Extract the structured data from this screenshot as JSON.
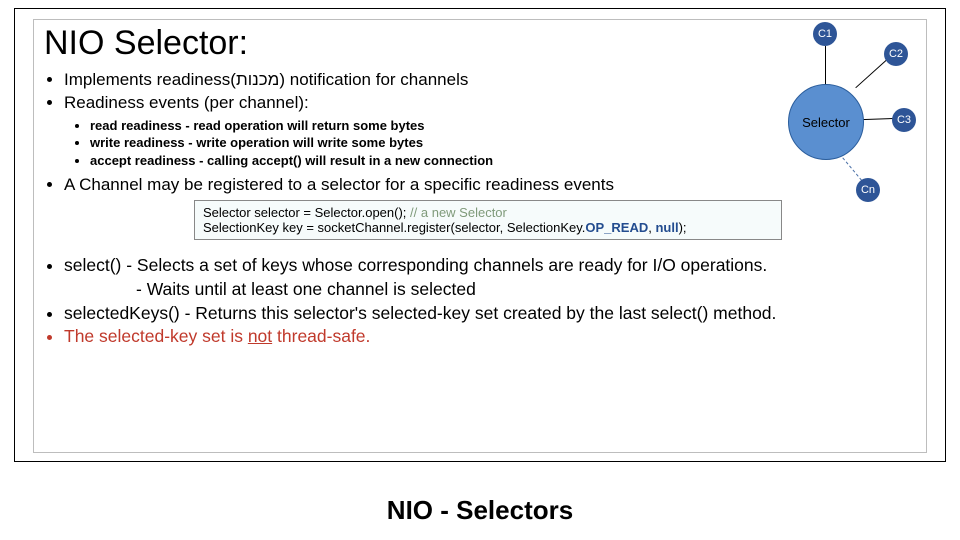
{
  "title": "NIO Selector:",
  "bullets_top": [
    "Implements readiness(מכנות) notification for channels",
    "Readiness events (per channel):"
  ],
  "bullets_sub": [
    "read readiness  -   read operation will return some bytes",
    "write readiness -   write operation will write some bytes",
    "accept readiness - calling accept() will result in a new connection"
  ],
  "bullet_register": "A Channel may be registered to a selector for a specific readiness events",
  "code": {
    "l1a": "Selector selector = Selector.open(); ",
    "l1b": "// a new Selector",
    "l2a": "SelectionKey key = socketChannel.register(selector, SelectionKey.",
    "l2b": "OP_READ",
    "l2c": ", ",
    "l2d": "null",
    "l2e": ");"
  },
  "bullets_bottom": {
    "b1a": "select() - Selects a set of keys whose corresponding channels are ready for I/O operations.",
    "b1b": "- Waits until at least one channel is selected",
    "b2": "selectedKeys() - Returns this selector's selected-key set created by the last select() method.",
    "b3a": "The selected-key set is ",
    "b3b": "not",
    "b3c": " thread-safe."
  },
  "diagram": {
    "selector": "Selector",
    "c1": "C1",
    "c2": "C2",
    "c3": "C3",
    "cn": "Cn"
  },
  "footer": "NIO - Selectors"
}
